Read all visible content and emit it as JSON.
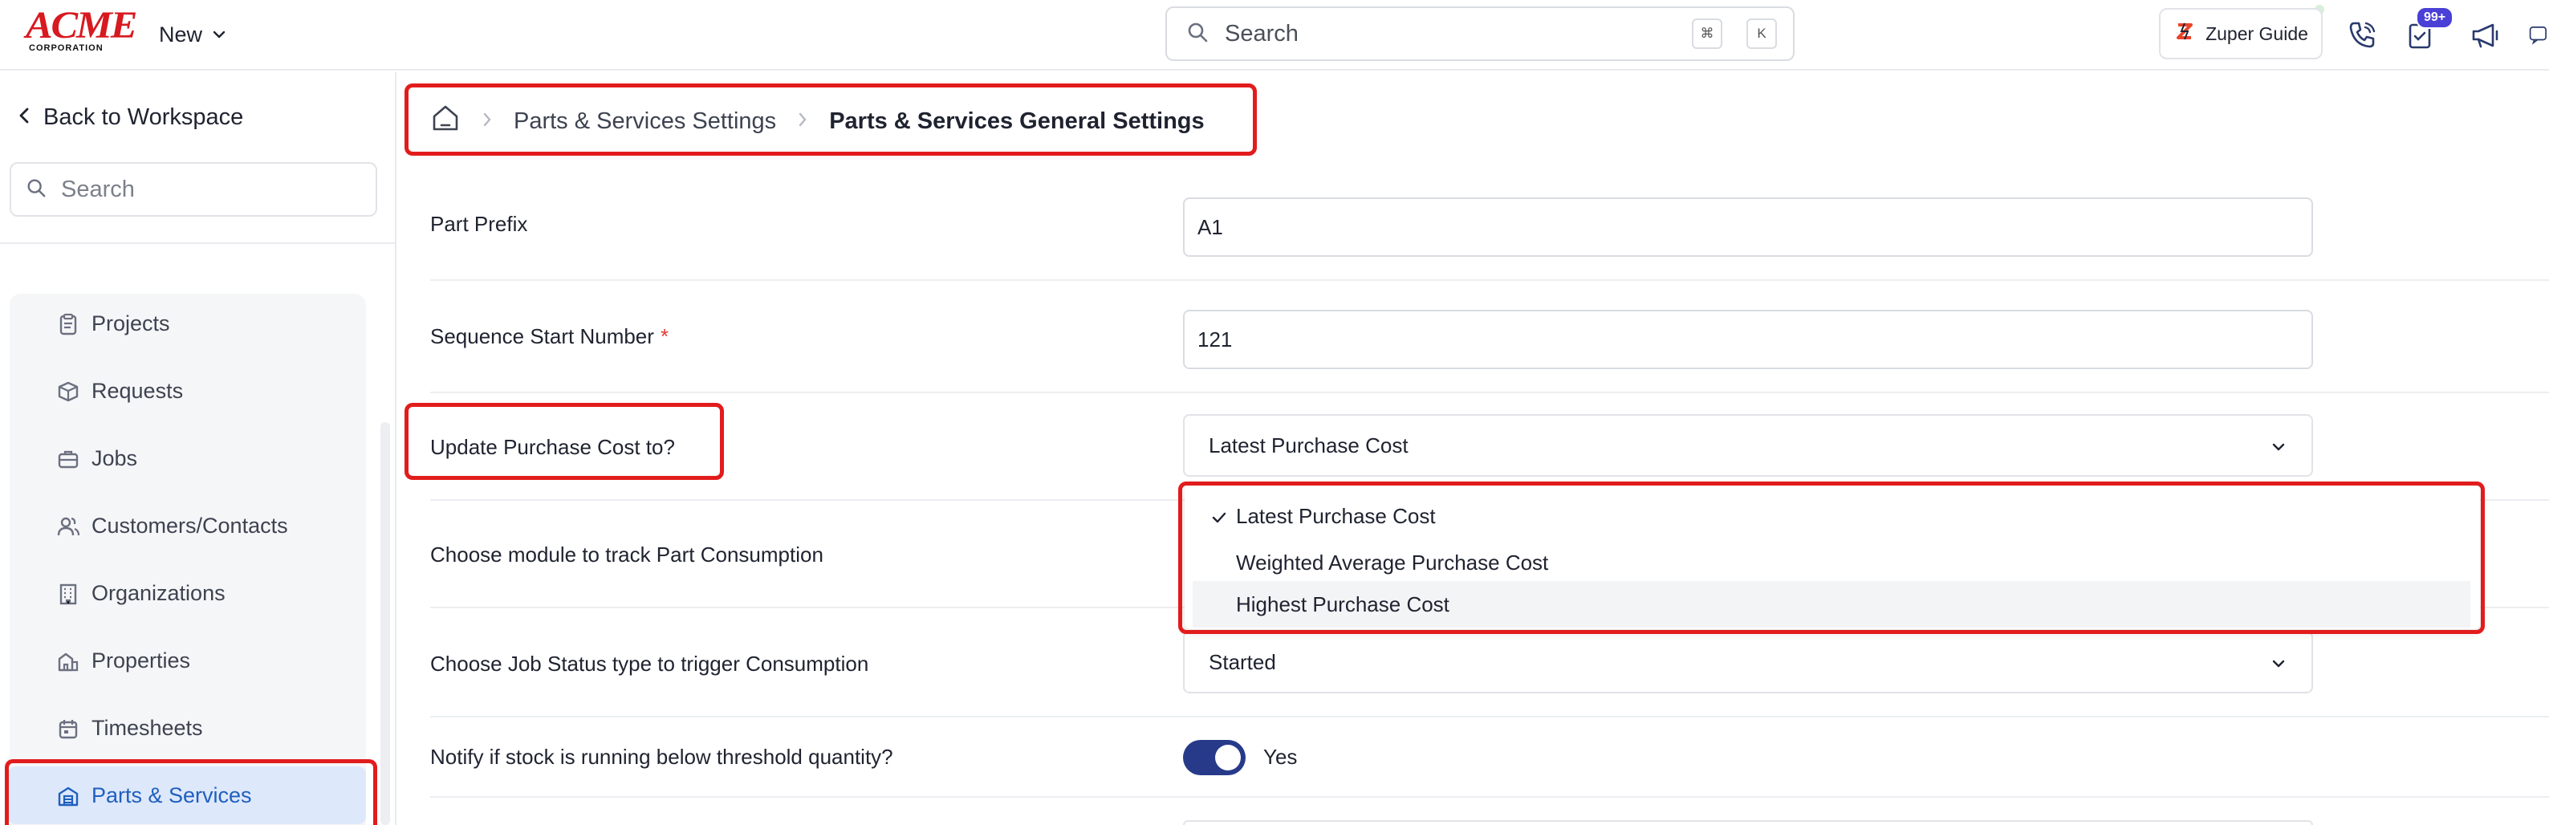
{
  "header": {
    "logo_main": "ACME",
    "logo_sub": "CORPORATION",
    "new_label": "New",
    "search_placeholder": "Search",
    "kbd_cmd": "⌘",
    "kbd_k": "K",
    "guide_label": "Zuper Guide",
    "notification_badge": "99+"
  },
  "sidebar": {
    "back_label": "Back to Workspace",
    "search_placeholder": "Search",
    "items": [
      {
        "label": "Projects",
        "icon": "clipboard-icon"
      },
      {
        "label": "Requests",
        "icon": "package-icon"
      },
      {
        "label": "Jobs",
        "icon": "briefcase-icon"
      },
      {
        "label": "Customers/Contacts",
        "icon": "users-icon"
      },
      {
        "label": "Organizations",
        "icon": "building-icon"
      },
      {
        "label": "Properties",
        "icon": "property-icon"
      },
      {
        "label": "Timesheets",
        "icon": "calendar-icon"
      },
      {
        "label": "Parts & Services",
        "icon": "warehouse-icon",
        "active": true
      }
    ]
  },
  "breadcrumb": {
    "home_icon": "home-icon",
    "items": [
      "Parts & Services Settings",
      "Parts & Services General Settings"
    ]
  },
  "form": {
    "part_prefix_label": "Part Prefix",
    "part_prefix_value": "A1",
    "sequence_label": "Sequence Start Number",
    "sequence_required": "*",
    "sequence_value": "121",
    "purchase_cost_label": "Update Purchase Cost to?",
    "purchase_cost_value": "Latest Purchase Cost",
    "module_label": "Choose module to track Part Consumption",
    "job_status_label": "Choose Job Status type to trigger Consumption",
    "job_status_value": "Started",
    "notify_label": "Notify if stock is running below threshold quantity?",
    "notify_value": "Yes"
  },
  "dropdown": {
    "options": [
      "Latest Purchase Cost",
      "Weighted Average Purchase Cost",
      "Highest Purchase Cost"
    ],
    "selected": "Latest Purchase Cost",
    "hovered": "Highest Purchase Cost"
  },
  "colors": {
    "brand_red": "#d71920",
    "highlight": "#e21c1c",
    "active_bg": "#dde8fa",
    "active_text": "#1f5fbf",
    "toggle_on": "#273a8a"
  }
}
